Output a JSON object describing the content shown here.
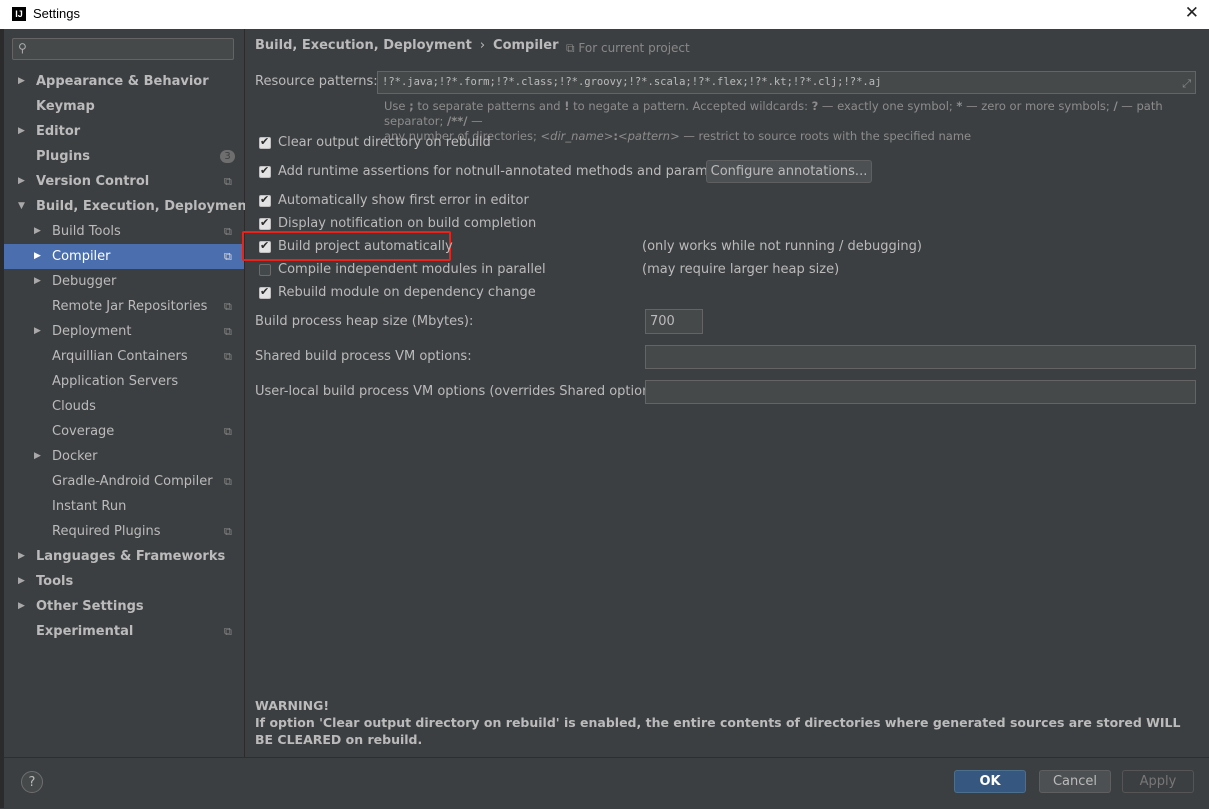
{
  "window": {
    "title": "Settings",
    "logo_text": "IJ",
    "close_glyph": "✕"
  },
  "sidebar": {
    "search_placeholder": "",
    "items": [
      {
        "label": "Appearance & Behavior",
        "arrow": "▶"
      },
      {
        "label": "Keymap"
      },
      {
        "label": "Editor",
        "arrow": "▶"
      },
      {
        "label": "Plugins",
        "badge": "3"
      },
      {
        "label": "Version Control",
        "arrow": "▶"
      },
      {
        "label": "Build, Execution, Deployment",
        "arrow": "▼"
      },
      {
        "label": "Build Tools",
        "arrow": "▶"
      },
      {
        "label": "Compiler",
        "arrow": "▶"
      },
      {
        "label": "Debugger",
        "arrow": "▶"
      },
      {
        "label": "Remote Jar Repositories"
      },
      {
        "label": "Deployment",
        "arrow": "▶"
      },
      {
        "label": "Arquillian Containers"
      },
      {
        "label": "Application Servers"
      },
      {
        "label": "Clouds"
      },
      {
        "label": "Coverage"
      },
      {
        "label": "Docker",
        "arrow": "▶"
      },
      {
        "label": "Gradle-Android Compiler"
      },
      {
        "label": "Instant Run"
      },
      {
        "label": "Required Plugins"
      },
      {
        "label": "Languages & Frameworks",
        "arrow": "▶"
      },
      {
        "label": "Tools",
        "arrow": "▶"
      },
      {
        "label": "Other Settings",
        "arrow": "▶"
      },
      {
        "label": "Experimental"
      }
    ],
    "copy_icon_glyph": "⧉"
  },
  "content": {
    "breadcrumb": {
      "parent": "Build, Execution, Deployment",
      "sep": "›",
      "current": "Compiler"
    },
    "for_current_project": "For current project",
    "resource_patterns": {
      "label": "Resource patterns:",
      "value": "!?*.java;!?*.form;!?*.class;!?*.groovy;!?*.scala;!?*.flex;!?*.kt;!?*.clj;!?*.aj"
    },
    "hint": {
      "p1": "Use ",
      "semi": ";",
      "p2": " to separate patterns and ",
      "bang": "!",
      "p3": " to negate a pattern. Accepted wildcards: ",
      "q": "?",
      "p4": " — exactly one symbol; ",
      "star": "*",
      "p5": " — zero or more symbols; ",
      "slash": "/",
      "p6": " — path separator; ",
      "dstar": "/**/",
      "p7": " —",
      "line2a": "any number of directories; ",
      "dirname": "<dir_name>",
      "colon": ":",
      "pattern": "<pattern>",
      "line2b": " — restrict to source roots with the specified name"
    },
    "checkboxes": [
      {
        "label": "Clear output directory on rebuild",
        "checked": true
      },
      {
        "label": "Add runtime assertions for notnull-annotated methods and parameters",
        "checked": true
      },
      {
        "label": "Automatically show first error in editor",
        "checked": true
      },
      {
        "label": "Display notification on build completion",
        "checked": true
      },
      {
        "label": "Build project automatically",
        "checked": true
      },
      {
        "label": "Compile independent modules in parallel",
        "checked": false
      },
      {
        "label": "Rebuild module on dependency change",
        "checked": true
      }
    ],
    "check_glyph": "✔",
    "configure_annotations": "Configure annotations...",
    "notes": {
      "build_auto": "(only works while not running / debugging)",
      "parallel": "(may require larger heap size)"
    },
    "heap": {
      "label": "Build process heap size (Mbytes):",
      "value": "700"
    },
    "shared_vm": {
      "label": "Shared build process VM options:",
      "value": ""
    },
    "user_vm": {
      "label": "User-local build process VM options (overrides Shared options):",
      "value": ""
    },
    "warning": {
      "title": "WARNING!",
      "text": "If option 'Clear output directory on rebuild' is enabled, the entire contents of directories where generated sources are stored WILL BE CLEARED on rebuild."
    }
  },
  "footer": {
    "help": "?",
    "ok": "OK",
    "cancel": "Cancel",
    "apply": "Apply"
  },
  "colors": {
    "background": "#3c3f41",
    "selection": "#4b6eaf",
    "highlight_box": "#e8231b",
    "ok_button": "#365880"
  }
}
